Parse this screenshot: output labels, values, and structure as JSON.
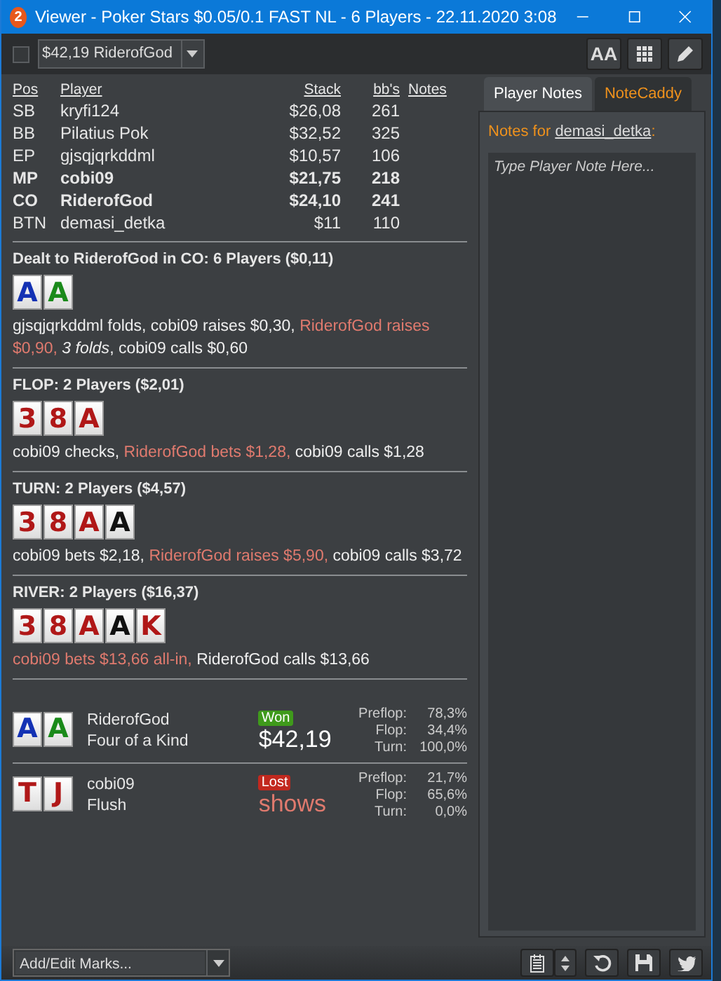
{
  "window": {
    "logo_text": "2",
    "title": "Viewer - Poker Stars $0.05/0.1 FAST NL - 6 Players - 22.11.2020 3:08"
  },
  "toolbar": {
    "checked": false,
    "hand_select": "$42,19 RiderofGod",
    "font_button": "AA"
  },
  "players": {
    "columns": [
      "Pos",
      "Player",
      "Stack",
      "bb's",
      "Notes"
    ],
    "rows": [
      {
        "pos": "SB",
        "name": "kryfi124",
        "stack": "$26,08",
        "bbs": "261",
        "in_hand": false
      },
      {
        "pos": "BB",
        "name": "Pilatius Pok",
        "stack": "$32,52",
        "bbs": "325",
        "in_hand": false
      },
      {
        "pos": "EP",
        "name": "gjsqjqrkddml",
        "stack": "$10,57",
        "bbs": "106",
        "in_hand": false
      },
      {
        "pos": "MP",
        "name": "cobi09",
        "stack": "$21,75",
        "bbs": "218",
        "in_hand": true
      },
      {
        "pos": "CO",
        "name": "RiderofGod",
        "stack": "$24,10",
        "bbs": "241",
        "in_hand": true
      },
      {
        "pos": "BTN",
        "name": "demasi_detka",
        "stack": "$11",
        "bbs": "110",
        "in_hand": false
      }
    ]
  },
  "streets": [
    {
      "title": "Dealt to RiderofGod in CO: 6 Players ($0,11)",
      "cards": [
        {
          "rank": "A",
          "color": "#1432b4"
        },
        {
          "rank": "A",
          "color": "#1a8a1a"
        }
      ],
      "actions": [
        {
          "text": "gjsqjqrkddml folds, cobi09 raises $0,30, ",
          "kind": "plain"
        },
        {
          "text": "RiderofGod raises $0,90, ",
          "kind": "hero"
        },
        {
          "text": "3 folds",
          "kind": "folds"
        },
        {
          "text": ", cobi09 calls $0,60",
          "kind": "plain"
        }
      ]
    },
    {
      "title": "FLOP: 2 Players ($2,01)",
      "cards": [
        {
          "rank": "3",
          "color": "#b01818"
        },
        {
          "rank": "8",
          "color": "#b01818"
        },
        {
          "rank": "A",
          "color": "#b01818"
        }
      ],
      "actions": [
        {
          "text": "cobi09 checks, ",
          "kind": "plain"
        },
        {
          "text": "RiderofGod bets $1,28,",
          "kind": "hero"
        },
        {
          "text": " cobi09 calls $1,28",
          "kind": "plain"
        }
      ]
    },
    {
      "title": "TURN: 2 Players ($4,57)",
      "cards": [
        {
          "rank": "3",
          "color": "#b01818"
        },
        {
          "rank": "8",
          "color": "#b01818"
        },
        {
          "rank": "A",
          "color": "#b01818"
        },
        {
          "rank": "A",
          "color": "#111111"
        }
      ],
      "actions": [
        {
          "text": "cobi09 bets $2,18, ",
          "kind": "plain"
        },
        {
          "text": "RiderofGod raises $5,90,",
          "kind": "hero"
        },
        {
          "text": " cobi09 calls $3,72",
          "kind": "plain"
        }
      ]
    },
    {
      "title": "RIVER: 2 Players ($16,37)",
      "cards": [
        {
          "rank": "3",
          "color": "#b01818"
        },
        {
          "rank": "8",
          "color": "#b01818"
        },
        {
          "rank": "A",
          "color": "#b01818"
        },
        {
          "rank": "A",
          "color": "#111111"
        },
        {
          "rank": "K",
          "color": "#b01818"
        }
      ],
      "actions": [
        {
          "text": "cobi09 bets $13,66 all-in,",
          "kind": "hero"
        },
        {
          "text": " RiderofGod calls $13,66",
          "kind": "plain"
        }
      ]
    }
  ],
  "results": [
    {
      "cards": [
        {
          "rank": "A",
          "color": "#1432b4"
        },
        {
          "rank": "A",
          "color": "#1a8a1a"
        }
      ],
      "name": "RiderofGod",
      "hand": "Four of a Kind",
      "badge": "Won",
      "kind": "won",
      "amount": "$42,19",
      "equity": [
        {
          "label": "Preflop:",
          "value": "78,3%"
        },
        {
          "label": "Flop:",
          "value": "34,4%"
        },
        {
          "label": "Turn:",
          "value": "100,0%"
        }
      ]
    },
    {
      "cards": [
        {
          "rank": "T",
          "color": "#b01818"
        },
        {
          "rank": "J",
          "color": "#b01818"
        }
      ],
      "name": "cobi09",
      "hand": "Flush",
      "badge": "Lost",
      "kind": "lost",
      "amount": "shows",
      "equity": [
        {
          "label": "Preflop:",
          "value": "21,7%"
        },
        {
          "label": "Flop:",
          "value": "65,6%"
        },
        {
          "label": "Turn:",
          "value": "0,0%"
        }
      ]
    }
  ],
  "notes_panel": {
    "tabs": [
      {
        "label": "Player Notes",
        "selected": true
      },
      {
        "label": "NoteCaddy",
        "selected": false
      }
    ],
    "notes_for": "Notes for ",
    "player": "demasi_detka",
    "suffix": ":",
    "placeholder": "Type Player Note Here..."
  },
  "bottom_bar": {
    "marks": "Add/Edit Marks..."
  }
}
